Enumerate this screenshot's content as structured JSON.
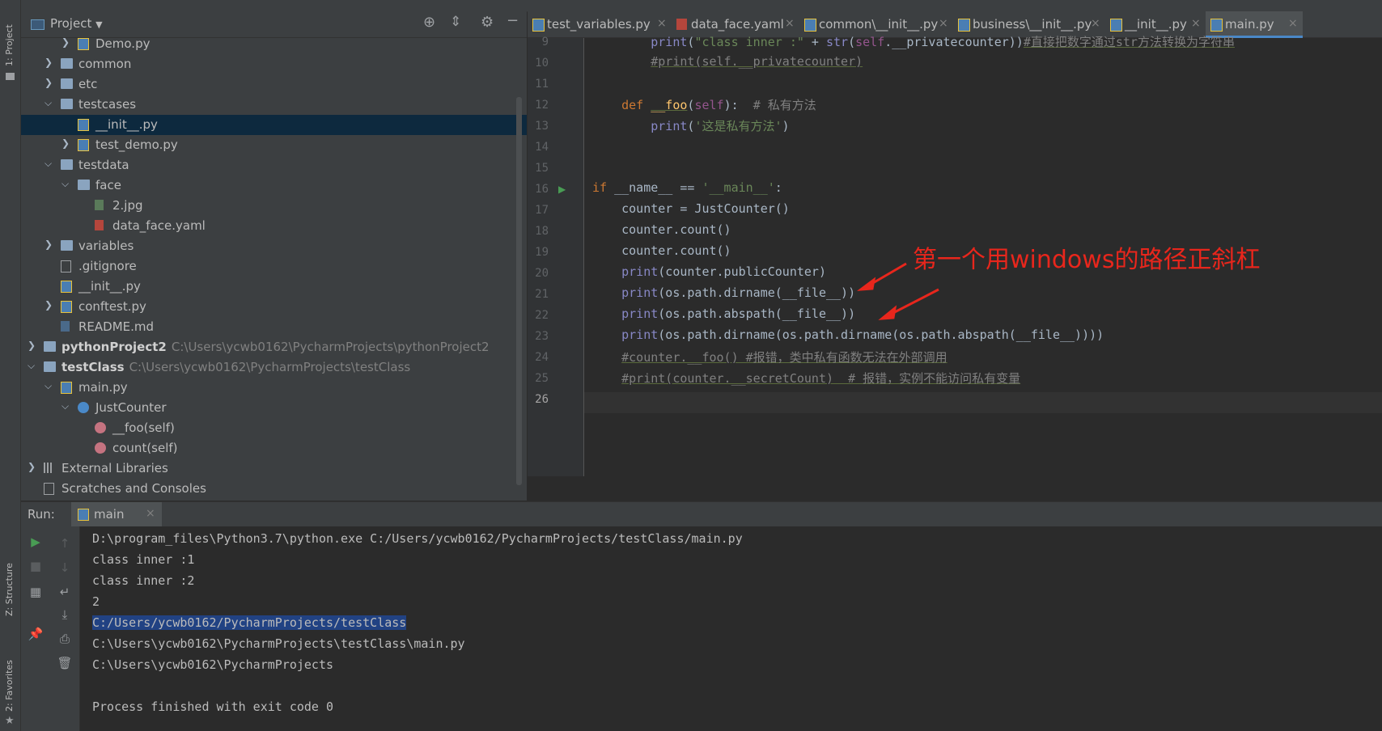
{
  "left_stripe": {
    "project_label": "1: Project",
    "structure_label": "Z: Structure",
    "favorites_label": "2: Favorites"
  },
  "project_panel": {
    "title": "Project",
    "tree": [
      {
        "label": "Demo.py",
        "icon": "python-file-icon",
        "arrow": "›",
        "indent": 2
      },
      {
        "label": "common",
        "icon": "folder-icon",
        "arrow": "›",
        "indent": 1
      },
      {
        "label": "etc",
        "icon": "folder-icon",
        "arrow": "›",
        "indent": 1
      },
      {
        "label": "testcases",
        "icon": "folder-icon",
        "arrow": "⌄",
        "indent": 1
      },
      {
        "label": "__init__.py",
        "icon": "python-file-icon",
        "arrow": "",
        "indent": 2,
        "selected": true
      },
      {
        "label": "test_demo.py",
        "icon": "python-file-icon",
        "arrow": "›",
        "indent": 2
      },
      {
        "label": "testdata",
        "icon": "folder-icon",
        "arrow": "⌄",
        "indent": 1
      },
      {
        "label": "face",
        "icon": "folder-icon",
        "arrow": "⌄",
        "indent": 2
      },
      {
        "label": "2.jpg",
        "icon": "image-file-icon",
        "arrow": "",
        "indent": 3
      },
      {
        "label": "data_face.yaml",
        "icon": "yaml-file-icon",
        "arrow": "",
        "indent": 3
      },
      {
        "label": "variables",
        "icon": "folder-icon",
        "arrow": "›",
        "indent": 1
      },
      {
        "label": ".gitignore",
        "icon": "gitignore-file-icon",
        "arrow": "",
        "indent": 1
      },
      {
        "label": "__init__.py",
        "icon": "python-file-icon",
        "arrow": "",
        "indent": 1
      },
      {
        "label": "conftest.py",
        "icon": "python-file-icon",
        "arrow": "›",
        "indent": 1
      },
      {
        "label": "README.md",
        "icon": "markdown-file-icon",
        "arrow": "",
        "indent": 1
      },
      {
        "label": "pythonProject2",
        "path": "C:\\Users\\ycwb0162\\PycharmProjects\\pythonProject2",
        "icon": "project-folder-icon",
        "arrow": "›",
        "indent": 0,
        "bold": true
      },
      {
        "label": "testClass",
        "path": "C:\\Users\\ycwb0162\\PycharmProjects\\testClass",
        "icon": "project-folder-icon",
        "arrow": "⌄",
        "indent": 0,
        "bold": true
      },
      {
        "label": "main.py",
        "icon": "python-file-icon",
        "arrow": "⌄",
        "indent": 1
      },
      {
        "label": "JustCounter",
        "icon": "class-icon",
        "arrow": "⌄",
        "indent": 2
      },
      {
        "label": "__foo(self)",
        "icon": "method-icon",
        "arrow": "",
        "indent": 3
      },
      {
        "label": "count(self)",
        "icon": "method-icon",
        "arrow": "",
        "indent": 3
      },
      {
        "label": "External Libraries",
        "icon": "library-icon",
        "arrow": "›",
        "indent": 0
      },
      {
        "label": "Scratches and Consoles",
        "icon": "scratches-icon",
        "arrow": "",
        "indent": 0
      }
    ]
  },
  "tabs": [
    {
      "label": "test_variables.py",
      "icon": "python-file-icon"
    },
    {
      "label": "data_face.yaml",
      "icon": "yaml-file-icon"
    },
    {
      "label": "common\\__init__.py",
      "icon": "python-file-icon"
    },
    {
      "label": "business\\__init__.py",
      "icon": "python-file-icon"
    },
    {
      "label": "__init__.py",
      "icon": "python-file-icon"
    },
    {
      "label": "main.py",
      "icon": "python-file-icon",
      "active": true
    }
  ],
  "editor": {
    "line_numbers": [
      "9",
      "10",
      "11",
      "12",
      "13",
      "14",
      "15",
      "16",
      "17",
      "18",
      "19",
      "20",
      "21",
      "22",
      "23",
      "24",
      "25",
      "26"
    ],
    "annotation": "第一个用windows的路径正斜杠"
  },
  "run": {
    "label": "Run:",
    "tab_label": "main",
    "output": [
      "D:\\program_files\\Python3.7\\python.exe C:/Users/ycwb0162/PycharmProjects/testClass/main.py",
      "class inner :1",
      "class inner :2",
      "2",
      "C:/Users/ycwb0162/PycharmProjects/testClass",
      "C:\\Users\\ycwb0162\\PycharmProjects\\testClass\\main.py",
      "C:\\Users\\ycwb0162\\PycharmProjects",
      "",
      "Process finished with exit code 0"
    ]
  },
  "colors": {
    "accent": "#4a88c7",
    "annotation": "#e8261c",
    "selection": "#214283"
  }
}
